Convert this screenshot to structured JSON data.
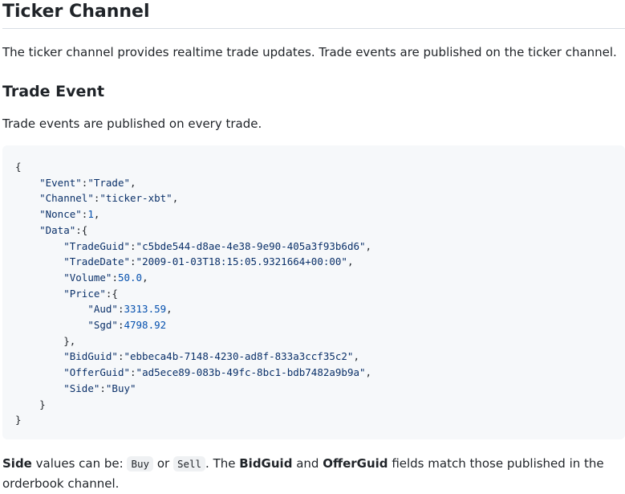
{
  "section": {
    "title": "Ticker Channel",
    "intro": "The ticker channel provides realtime trade updates. Trade events are published on the ticker channel."
  },
  "trade_event": {
    "title": "Trade Event",
    "description": "Trade events are published on every trade.",
    "code": {
      "event_key": "\"Event\"",
      "event_val": "\"Trade\"",
      "channel_key": "\"Channel\"",
      "channel_val": "\"ticker-xbt\"",
      "nonce_key": "\"Nonce\"",
      "nonce_val": "1",
      "data_key": "\"Data\"",
      "trade_guid_key": "\"TradeGuid\"",
      "trade_guid_val": "\"c5bde544-d8ae-4e38-9e90-405a3f93b6d6\"",
      "trade_date_key": "\"TradeDate\"",
      "trade_date_val": "\"2009-01-03T18:15:05.9321664+00:00\"",
      "volume_key": "\"Volume\"",
      "volume_val": "50.0",
      "price_key": "\"Price\"",
      "aud_key": "\"Aud\"",
      "aud_val": "3313.59",
      "sgd_key": "\"Sgd\"",
      "sgd_val": "4798.92",
      "bid_guid_key": "\"BidGuid\"",
      "bid_guid_val": "\"ebbeca4b-7148-4230-ad8f-833a3ccf35c2\"",
      "offer_guid_key": "\"OfferGuid\"",
      "offer_guid_val": "\"ad5ece89-083b-49fc-8bc1-bdb7482a9b9a\"",
      "side_key": "\"Side\"",
      "side_val": "\"Buy\""
    }
  },
  "footer_note": {
    "side_label": "Side",
    "text1": " values can be: ",
    "buy": "Buy",
    "or": " or ",
    "sell": "Sell",
    "text2": ". The ",
    "bid_guid": "BidGuid",
    "and": " and ",
    "offer_guid": "OfferGuid",
    "text3": " fields match those published in the orderbook channel."
  }
}
